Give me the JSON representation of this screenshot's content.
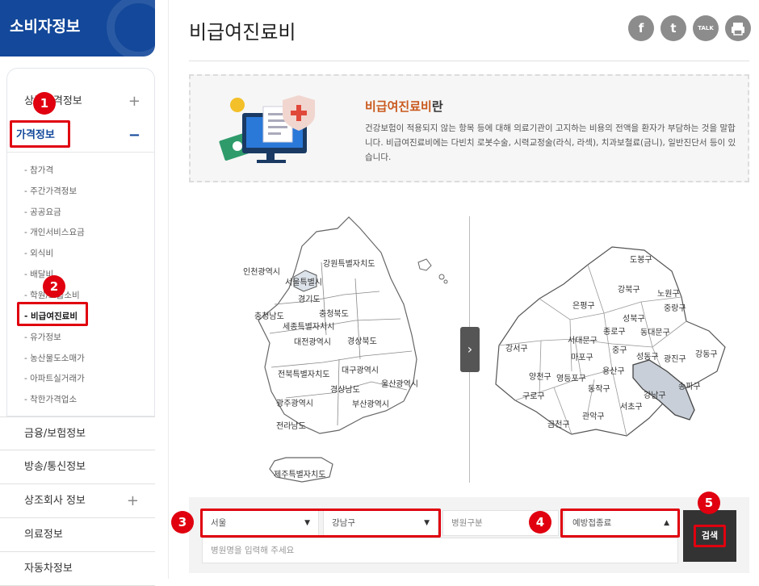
{
  "sidebar": {
    "title": "소비자정보",
    "items": [
      {
        "label": "상품가격정보"
      },
      {
        "label": "가격정보"
      }
    ],
    "subitems": [
      "참가격",
      "주간가격정보",
      "공공요금",
      "개인서비스요금",
      "외식비",
      "배달비",
      "학원/교습소비",
      "비급여진료비",
      "유가정보",
      "농산물도소매가",
      "아파트실거래가",
      "착한가격업소"
    ],
    "lower": [
      "금융/보험정보",
      "방송/통신정보",
      "상조회사 정보",
      "의료정보",
      "자동차정보"
    ]
  },
  "page": {
    "title": "비급여진료비",
    "share": {
      "fb": "f",
      "tw": "t",
      "talk": "TALK",
      "print": "print-icon"
    }
  },
  "info": {
    "heading_accent": "비급여진료비",
    "heading_rest": "란",
    "desc": "건강보험이 적용되지 않는 항목 등에 대해 의료기관이 고지하는 비용의 전액을 환자가 부담하는 것을 말합니다. 비급여진료비에는 다빈치 로봇수술, 시력교정술(라식, 라섹), 치과보철료(금니), 일반진단서 등이 있습니다."
  },
  "korea_map": [
    "인천광역시",
    "강원특별자치도",
    "서울특별시",
    "경기도",
    "충청남도",
    "충청북도",
    "세종특별자치시",
    "대전광역시",
    "경상북도",
    "전북특별자치도",
    "대구광역시",
    "울산광역시",
    "경상남도",
    "광주광역시",
    "부산광역시",
    "전라남도",
    "제주특별자치도"
  ],
  "seoul_map": [
    "도봉구",
    "강북구",
    "노원구",
    "은평구",
    "성북구",
    "중랑구",
    "종로구",
    "동대문구",
    "서대문구",
    "강서구",
    "마포구",
    "중구",
    "성동구",
    "광진구",
    "강동구",
    "용산구",
    "양천구",
    "영등포구",
    "동작구",
    "강남구",
    "송파구",
    "구로구",
    "서초구",
    "관악구",
    "금천구"
  ],
  "search": {
    "region": "서울",
    "district": "강남구",
    "hospital_type_placeholder": "병원구분",
    "vaccine": "예방접종료",
    "name_placeholder": "병원명을 입력해 주세요",
    "button": "검색"
  },
  "badges": [
    "1",
    "2",
    "3",
    "4",
    "5"
  ],
  "colors": {
    "accent": "#13489a",
    "red": "#e0000f",
    "heading": "#c9591d",
    "selected_district": "#c8cfd8"
  }
}
